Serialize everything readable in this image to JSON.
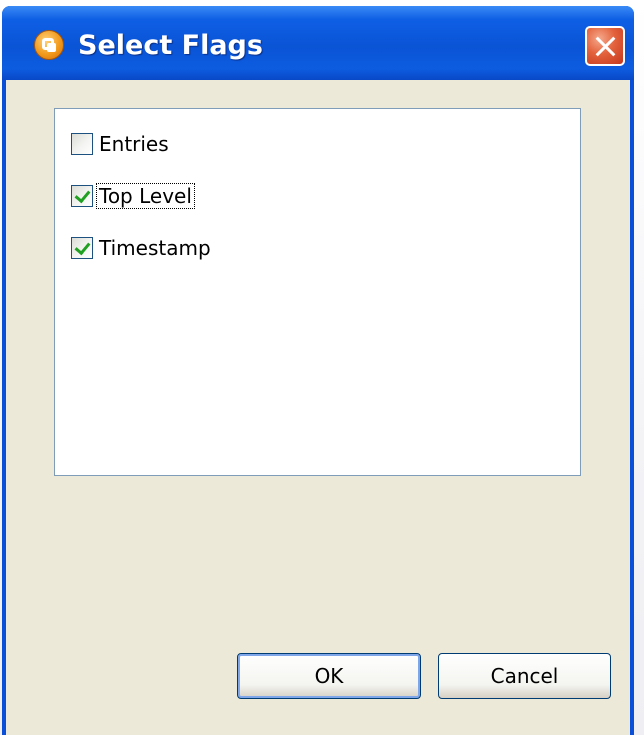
{
  "window": {
    "title": "Select Flags",
    "close_icon": "close-icon",
    "app_icon": "app-icon"
  },
  "flags": [
    {
      "label": "Entries",
      "checked": false,
      "focused": false
    },
    {
      "label": "Top Level",
      "checked": true,
      "focused": true
    },
    {
      "label": "Timestamp",
      "checked": true,
      "focused": false
    }
  ],
  "buttons": {
    "ok_label": "OK",
    "cancel_label": "Cancel"
  },
  "colors": {
    "titlebar": "#0a54d6",
    "check": "#21a121",
    "dialog_face": "#ece9d8",
    "close_button": "#e3623c"
  }
}
